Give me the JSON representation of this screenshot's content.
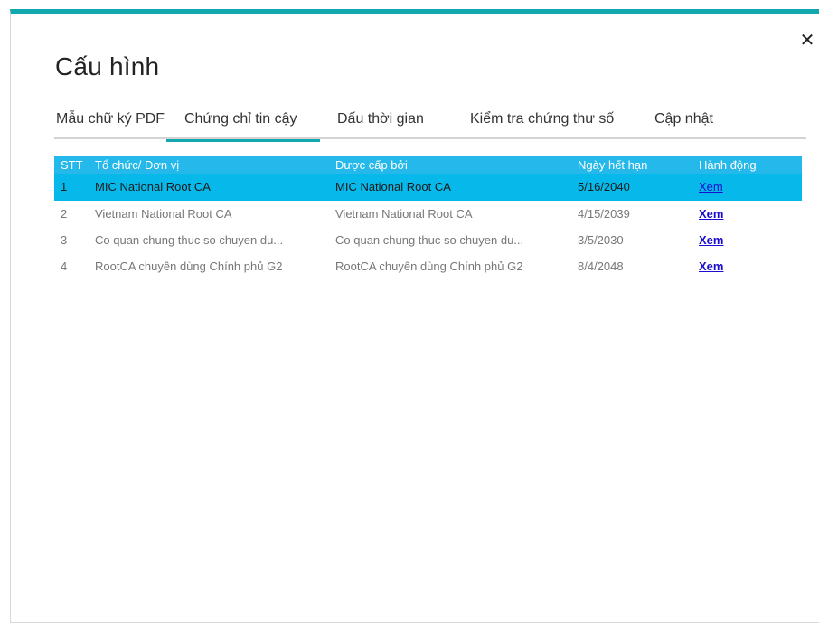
{
  "dialog": {
    "title": "Cấu hình",
    "close_label": "✕"
  },
  "tabs": [
    {
      "label": "Mẫu chữ ký PDF",
      "active": false
    },
    {
      "label": "Chứng chỉ tin cậy",
      "active": true
    },
    {
      "label": "Dấu thời gian",
      "active": false
    },
    {
      "label": "Kiểm tra chứng thư số",
      "active": false
    },
    {
      "label": "Cập nhật",
      "active": false
    }
  ],
  "table": {
    "headers": {
      "stt": "STT",
      "org": "Tổ chức/ Đơn vị",
      "issuer": "Được cấp bởi",
      "expiry": "Ngày hết hạn",
      "action": "Hành động"
    },
    "rows": [
      {
        "stt": "1",
        "org": "MIC National Root CA",
        "issuer": "MIC National Root CA",
        "expiry": "5/16/2040",
        "action": "Xem",
        "selected": true
      },
      {
        "stt": "2",
        "org": "Vietnam National Root CA",
        "issuer": "Vietnam National Root CA",
        "expiry": "4/15/2039",
        "action": "Xem",
        "selected": false
      },
      {
        "stt": "3",
        "org": "Co quan chung thuc so chuyen du...",
        "issuer": "Co quan chung thuc so chuyen du...",
        "expiry": "3/5/2030",
        "action": "Xem",
        "selected": false
      },
      {
        "stt": "4",
        "org": "RootCA chuyên dùng Chính phủ G2",
        "issuer": "RootCA chuyên dùng Chính phủ G2",
        "expiry": "8/4/2048",
        "action": "Xem",
        "selected": false
      }
    ]
  },
  "colors": {
    "accent": "#11a7ad",
    "header_bg": "#25b8ea",
    "selected_bg": "#06b9ea",
    "link": "#1a0dcf"
  }
}
